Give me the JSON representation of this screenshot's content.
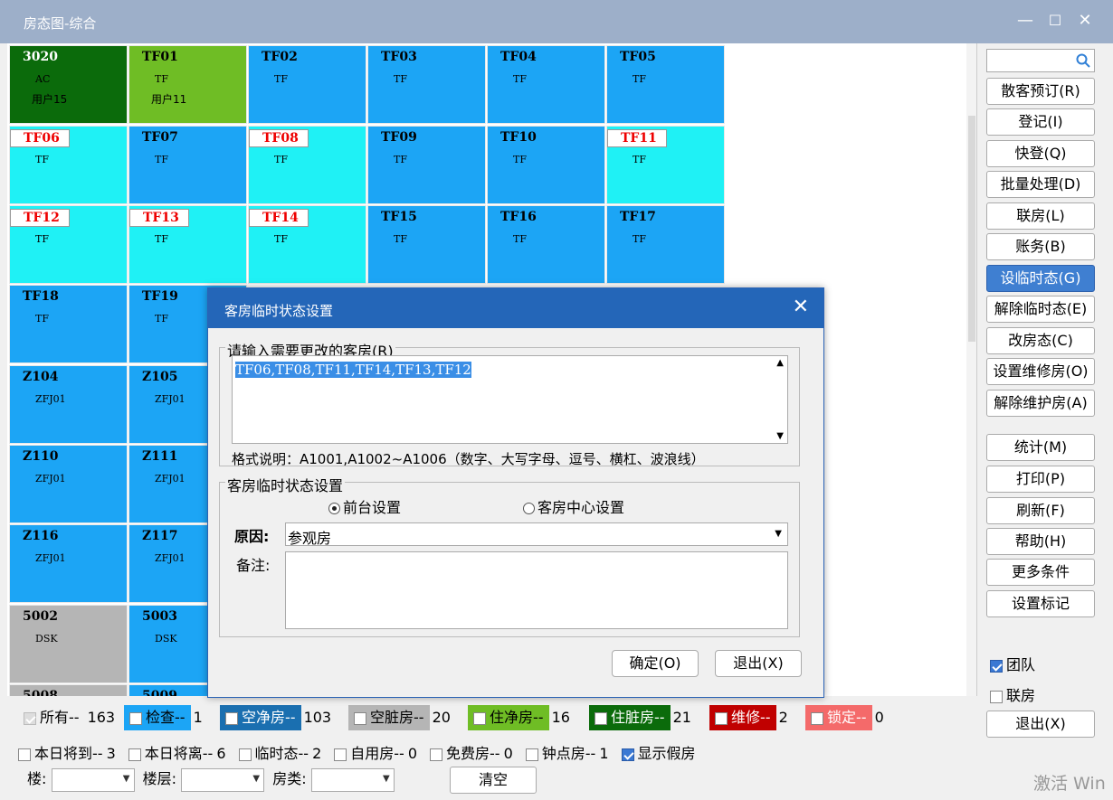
{
  "window": {
    "title": "房态图-综合",
    "min": "—",
    "max": "☐",
    "close": "✕"
  },
  "colors": {
    "green_dark": "#0b6b0b",
    "green_light": "#6fbd25",
    "blue": "#1ca5f5",
    "cyan": "#1ff1f5",
    "gray": "#b5b5b5",
    "red": "#c00000",
    "pink": "#f46a6a",
    "blue_dark": "#1a6fb0"
  },
  "rooms": [
    {
      "no": "3020",
      "type": "AC",
      "user": "用户15",
      "color": "#0b6b0b"
    },
    {
      "no": "TF01",
      "type": "TF",
      "user": "用户11",
      "color": "#6fbd25"
    },
    {
      "no": "TF02",
      "type": "TF",
      "color": "#1ca5f5"
    },
    {
      "no": "TF03",
      "type": "TF",
      "color": "#1ca5f5"
    },
    {
      "no": "TF04",
      "type": "TF",
      "color": "#1ca5f5"
    },
    {
      "no": "TF05",
      "type": "TF",
      "color": "#1ca5f5"
    },
    {
      "no": "TF06",
      "type": "TF",
      "color": "#1ff1f5",
      "tag": true
    },
    {
      "no": "TF07",
      "type": "TF",
      "color": "#1ca5f5"
    },
    {
      "no": "TF08",
      "type": "TF",
      "color": "#1ff1f5",
      "tag": true
    },
    {
      "no": "TF09",
      "type": "TF",
      "color": "#1ca5f5"
    },
    {
      "no": "TF10",
      "type": "TF",
      "color": "#1ca5f5"
    },
    {
      "no": "TF11",
      "type": "TF",
      "color": "#1ff1f5",
      "tag": true
    },
    {
      "no": "TF12",
      "type": "TF",
      "color": "#1ff1f5",
      "tag": true
    },
    {
      "no": "TF13",
      "type": "TF",
      "color": "#1ff1f5",
      "tag": true
    },
    {
      "no": "TF14",
      "type": "TF",
      "color": "#1ff1f5",
      "tag": true
    },
    {
      "no": "TF15",
      "type": "TF",
      "color": "#1ca5f5"
    },
    {
      "no": "TF16",
      "type": "TF",
      "color": "#1ca5f5"
    },
    {
      "no": "TF17",
      "type": "TF",
      "color": "#1ca5f5"
    },
    {
      "no": "TF18",
      "type": "TF",
      "color": "#1ca5f5"
    },
    {
      "no": "TF19",
      "type": "TF",
      "color": "#1ca5f5"
    },
    {
      "no": "Z104",
      "type": "ZFJ01",
      "color": "#1ca5f5"
    },
    {
      "no": "Z105",
      "type": "ZFJ01",
      "color": "#1ca5f5"
    },
    {
      "no": "Z110",
      "type": "ZFJ01",
      "color": "#1ca5f5"
    },
    {
      "no": "Z111",
      "type": "ZFJ01",
      "color": "#1ca5f5"
    },
    {
      "no": "Z116",
      "type": "ZFJ01",
      "color": "#1ca5f5"
    },
    {
      "no": "Z117",
      "type": "ZFJ01",
      "color": "#1ca5f5"
    },
    {
      "no": "5002",
      "type": "DSK",
      "color": "#b5b5b5"
    },
    {
      "no": "5003",
      "type": "DSK",
      "color": "#1ca5f5"
    },
    {
      "no": "5008",
      "type": "",
      "color": "#b5b5b5"
    },
    {
      "no": "5009",
      "type": "",
      "color": "#1ca5f5"
    }
  ],
  "sidebar": {
    "search_icon": "search-icon",
    "buttons": [
      "散客预订(R)",
      "登记(I)",
      "快登(Q)",
      "批量处理(D)",
      "联房(L)",
      "账务(B)",
      "设临时态(G)",
      "解除临时态(E)",
      "改房态(C)",
      "设置维修房(O)",
      "解除维护房(A)"
    ],
    "buttons2": [
      "统计(M)",
      "打印(P)",
      "刷新(F)",
      "帮助(H)",
      "更多条件",
      "设置标记"
    ],
    "team": "团队",
    "linked": "联房",
    "exit": "退出(X)"
  },
  "legend": [
    {
      "label": "所有--",
      "count": "163"
    },
    {
      "label": "检查--",
      "count": "1",
      "color": "#1ca5f5"
    },
    {
      "label": "空净房--",
      "count": "103",
      "color": "#1a6fb0"
    },
    {
      "label": "空脏房--",
      "count": "20",
      "color": "#b5b5b5"
    },
    {
      "label": "住净房--",
      "count": "16",
      "color": "#6fbd25"
    },
    {
      "label": "住脏房--",
      "count": "21",
      "color": "#0b6b0b"
    },
    {
      "label": "维修--",
      "count": "2",
      "color": "#c00000"
    },
    {
      "label": "锁定--",
      "count": "0",
      "color": "#f46a6a"
    }
  ],
  "filters": [
    {
      "label": "本日将到--",
      "count": "3"
    },
    {
      "label": "本日将离--",
      "count": "6"
    },
    {
      "label": "临时态--",
      "count": "2"
    },
    {
      "label": "自用房--",
      "count": "0"
    },
    {
      "label": "免费房--",
      "count": "0"
    },
    {
      "label": "钟点房--",
      "count": "1"
    }
  ],
  "show_fake": "显示假房",
  "selects": {
    "building": "楼:",
    "floor": "楼层:",
    "room_type": "房类:",
    "clear": "清空"
  },
  "dialog": {
    "title": "客房临时状态设置",
    "group1_label": "请输入需要更改的客房(R)",
    "rooms_value": "TF06,TF08,TF11,TF14,TF13,TF12",
    "format_hint": "格式说明：A1001,A1002~A1006（数字、大写字母、逗号、横杠、波浪线）",
    "group2_label": "客房临时状态设置",
    "radio1": "前台设置",
    "radio2": "客房中心设置",
    "reason_label": "原因:",
    "reason_value": "参观房",
    "remark_label": "备注:",
    "ok": "确定(O)",
    "cancel": "退出(X)"
  },
  "watermark": "激活 Win"
}
